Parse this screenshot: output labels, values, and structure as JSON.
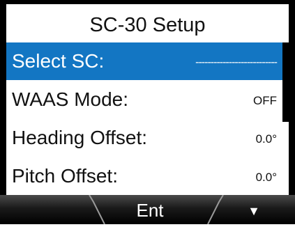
{
  "screen": {
    "title": "SC-30 Setup",
    "menu": [
      {
        "label": "Select SC:",
        "value": "---------------------------",
        "selected": true
      },
      {
        "label": "WAAS Mode:",
        "value": "OFF",
        "selected": false
      },
      {
        "label": "Heading Offset:",
        "value": "0.0°",
        "selected": false
      },
      {
        "label": "Pitch Offset:",
        "value": "0.0°",
        "selected": false
      }
    ]
  },
  "softkeys": {
    "left": "",
    "center": "Ent",
    "right_icon": "down-triangle-icon",
    "right_glyph": "▼"
  },
  "colors": {
    "highlight": "#1376c3",
    "border": "#000000"
  }
}
